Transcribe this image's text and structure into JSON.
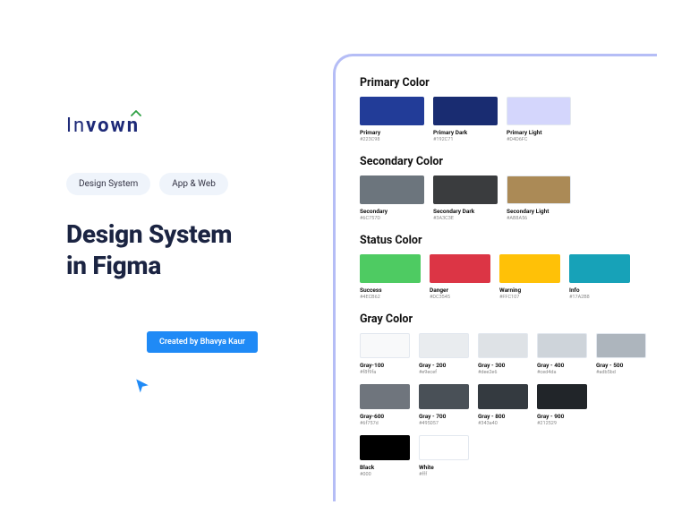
{
  "logo": {
    "part1": "In",
    "part2": "vown"
  },
  "pills": [
    "Design System",
    "App & Web"
  ],
  "headline_l1": "Design System",
  "headline_l2": "in Figma",
  "credit": "Created by Bhavya Kaur",
  "sections": {
    "primary": {
      "title": "Primary Color",
      "items": [
        {
          "name": "Primary",
          "hex": "#223C98"
        },
        {
          "name": "Primary Dark",
          "hex": "#192C71"
        },
        {
          "name": "Primary Light",
          "hex": "#D4D6FC"
        }
      ]
    },
    "secondary": {
      "title": "Secondary Color",
      "items": [
        {
          "name": "Secondary",
          "hex": "#6C757D"
        },
        {
          "name": "Secondary Dark",
          "hex": "#3A3C3E"
        },
        {
          "name": "Secondary Light",
          "hex": "#AB8A56"
        }
      ]
    },
    "status": {
      "title": "Status Color",
      "items": [
        {
          "name": "Success",
          "hex": "#4ECB62"
        },
        {
          "name": "Danger",
          "hex": "#DC3545"
        },
        {
          "name": "Warning",
          "hex": "#FFC107"
        },
        {
          "name": "Info",
          "hex": "#17A2B8"
        }
      ]
    },
    "gray": {
      "title": "Gray Color",
      "row1": [
        {
          "name": "Gray-100",
          "hex": "#f8f9fa"
        },
        {
          "name": "Gray - 200",
          "hex": "#e9ecef"
        },
        {
          "name": "Gray - 300",
          "hex": "#dee2e6"
        },
        {
          "name": "Gray - 400",
          "hex": "#ced4da"
        },
        {
          "name": "Gray - 500",
          "hex": "#adb5bd"
        }
      ],
      "row2": [
        {
          "name": "Gray-600",
          "hex": "#6f757d"
        },
        {
          "name": "Gray - 700",
          "hex": "#495057"
        },
        {
          "name": "Gray - 800",
          "hex": "#343a40"
        },
        {
          "name": "Gray - 900",
          "hex": "#212529"
        }
      ],
      "bw": [
        {
          "name": "Black",
          "hex": "#000"
        },
        {
          "name": "White",
          "hex": "#fff"
        }
      ]
    }
  }
}
